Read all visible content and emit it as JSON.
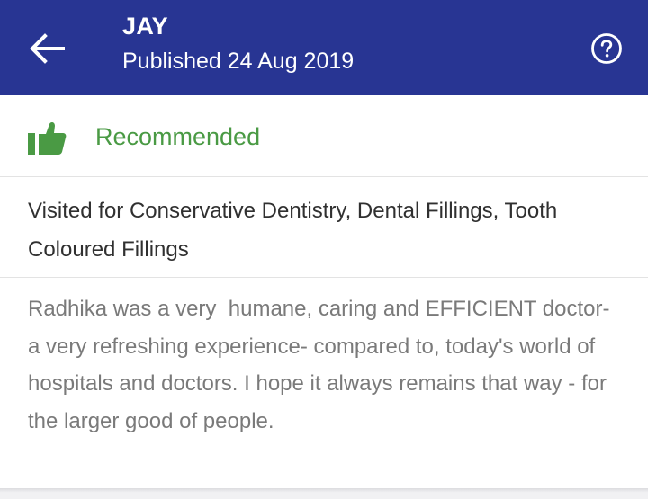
{
  "header": {
    "title": "JAY",
    "subtitle": "Published 24 Aug 2019",
    "back_icon": "arrow-left-icon",
    "help_icon": "help-circle-icon",
    "background": "#283593"
  },
  "recommendation": {
    "icon": "thumbs-up-icon",
    "label": "Recommended",
    "color": "#4a9a44"
  },
  "visit": {
    "text": "Visited for Conservative Dentistry, Dental Fillings, Tooth Coloured Fillings"
  },
  "review": {
    "text": "Radhika was a very  humane, caring and EFFICIENT doctor- a very refreshing experience- compared to, today's world of hospitals and doctors. I hope it always remains that way - for the larger good of people."
  }
}
